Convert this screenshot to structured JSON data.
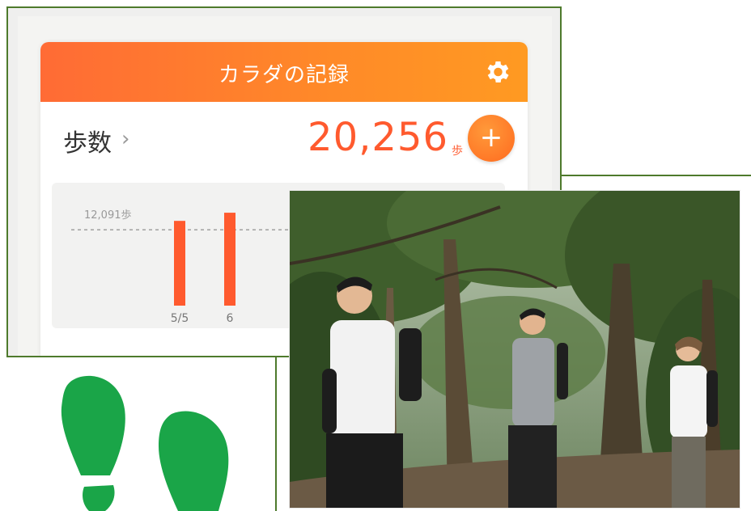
{
  "app": {
    "title": "カラダの記録",
    "settings_icon": "gear-icon",
    "steps_label": "歩数",
    "steps_chevron": "›",
    "steps_value": "20,256",
    "steps_unit": "歩",
    "add_button_label": "+",
    "accent_color": "#ff6b35"
  },
  "chart_data": {
    "type": "bar",
    "average_label": "12,091歩",
    "categories": [
      "5/5",
      "6"
    ],
    "values": [
      13500,
      14800
    ],
    "reference_line": 12091,
    "ylim": [
      0,
      17000
    ],
    "bar_color": "#ff5a2e"
  },
  "decor": {
    "photo": "hikers-on-forest-trail",
    "footprints_color": "#1aa548"
  }
}
